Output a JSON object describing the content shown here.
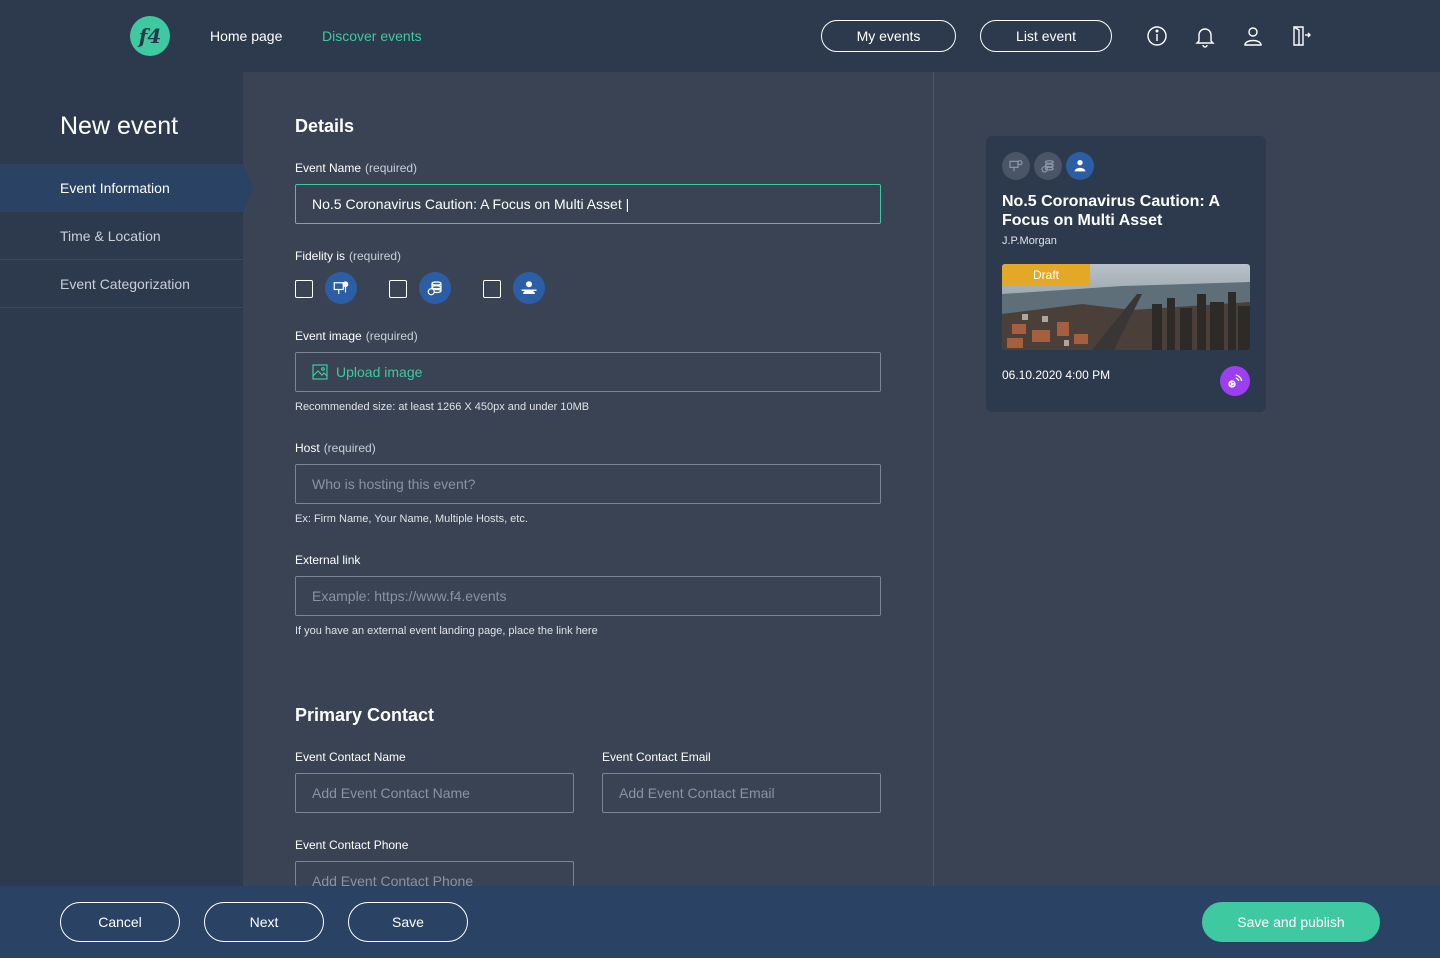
{
  "nav": {
    "logo_text": "f4",
    "home": "Home page",
    "discover": "Discover events",
    "my_events": "My events",
    "list_event": "List event",
    "icons": [
      "info-icon",
      "bell-icon",
      "user-icon",
      "logout-icon"
    ],
    "accent": "#3ec9a0"
  },
  "sidebar": {
    "title": "New event",
    "items": [
      {
        "label": "Event Information",
        "active": true
      },
      {
        "label": "Time & Location",
        "active": false
      },
      {
        "label": "Event Categorization",
        "active": false
      }
    ]
  },
  "details": {
    "title": "Details",
    "event_name": {
      "label": "Event Name",
      "req": "(required)",
      "value": "No.5 Coronavirus Caution: A Focus on Multi Asset |"
    },
    "fidelity": {
      "label": "Fidelity is",
      "req": "(required)",
      "options": [
        "presentation-icon",
        "finance-icon",
        "person-icon"
      ]
    },
    "event_image": {
      "label": "Event image",
      "req": "(required)",
      "upload": "Upload image",
      "hint": "Recommended size: at least 1266 X 450px and under 10MB"
    },
    "host": {
      "label": "Host",
      "req": "(required)",
      "placeholder": "Who is hosting this event?",
      "hint": "Ex: Firm Name, Your Name, Multiple Hosts, etc."
    },
    "external_link": {
      "label": "External link",
      "placeholder": "Example: https://www.f4.events",
      "hint": "If you have an external event landing page, place the link here"
    }
  },
  "contact": {
    "title": "Primary Contact",
    "name": {
      "label": "Event Contact Name",
      "placeholder": "Add Event Contact Name"
    },
    "email": {
      "label": "Event Contact Email",
      "placeholder": "Add Event Contact Email"
    },
    "phone": {
      "label": "Event Contact Phone",
      "placeholder": "Add Event Contact Phone"
    }
  },
  "preview": {
    "title": "No.5 Coronavirus Caution: A Focus on Multi Asset",
    "host": "J.P.Morgan",
    "badge": "Draft",
    "date": "06.10.2020 4:00 PM",
    "badge_color": "#e3a826"
  },
  "footer": {
    "cancel": "Cancel",
    "next": "Next",
    "save": "Save",
    "publish": "Save and publish"
  }
}
